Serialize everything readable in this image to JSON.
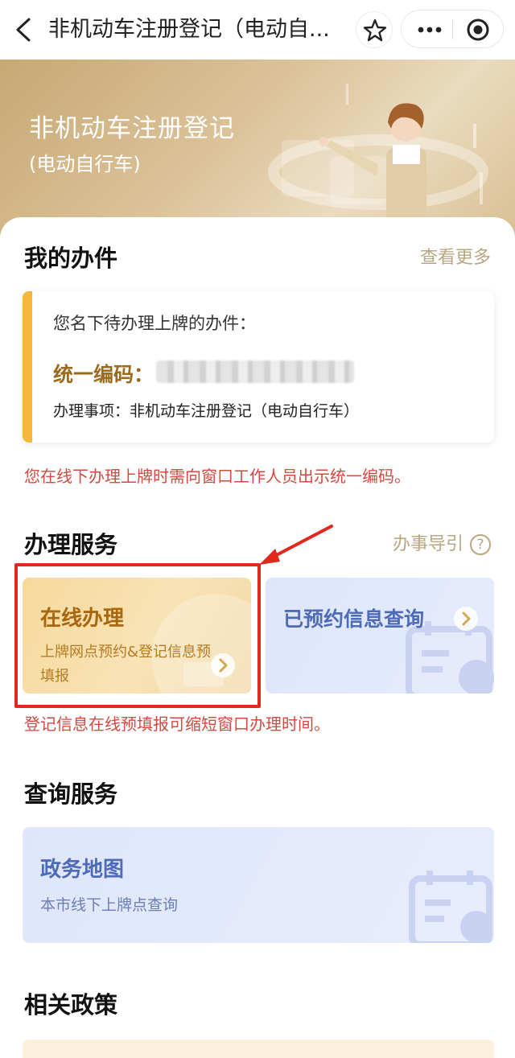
{
  "nav": {
    "title": "非机动车注册登记（电动自...",
    "icons": {
      "back": "back-chevron-icon",
      "star": "star-icon",
      "more": "more-dots-icon",
      "close": "target-circle-icon"
    }
  },
  "banner": {
    "title": "非机动车注册登记",
    "subtitle": "(电动自行车)"
  },
  "my_tasks": {
    "title": "我的办件",
    "more_label": "查看更多",
    "intro": "您名下待办理上牌的办件：",
    "code_label": "统一编码：",
    "item_label": "办理事项：非机动车注册登记（电动自行车）",
    "tip": "您在线下办理上牌时需向窗口工作人员出示统一编码。"
  },
  "services": {
    "title": "办理服务",
    "guide_label": "办事导引",
    "online": {
      "title": "在线办理",
      "desc": "上牌网点预约&登记信息预填报"
    },
    "booked": {
      "title": "已预约信息查询"
    },
    "tip": "登记信息在线预填报可缩短窗口办理时间。"
  },
  "query": {
    "title": "查询服务",
    "map": {
      "title": "政务地图",
      "desc": "本市线下上牌点查询"
    }
  },
  "policy": {
    "title": "相关政策"
  },
  "colors": {
    "accent_gold": "#b9a781",
    "tip_red": "#d6493f",
    "highlight_red": "#e0281f",
    "blue_title": "#4d6bb8"
  }
}
